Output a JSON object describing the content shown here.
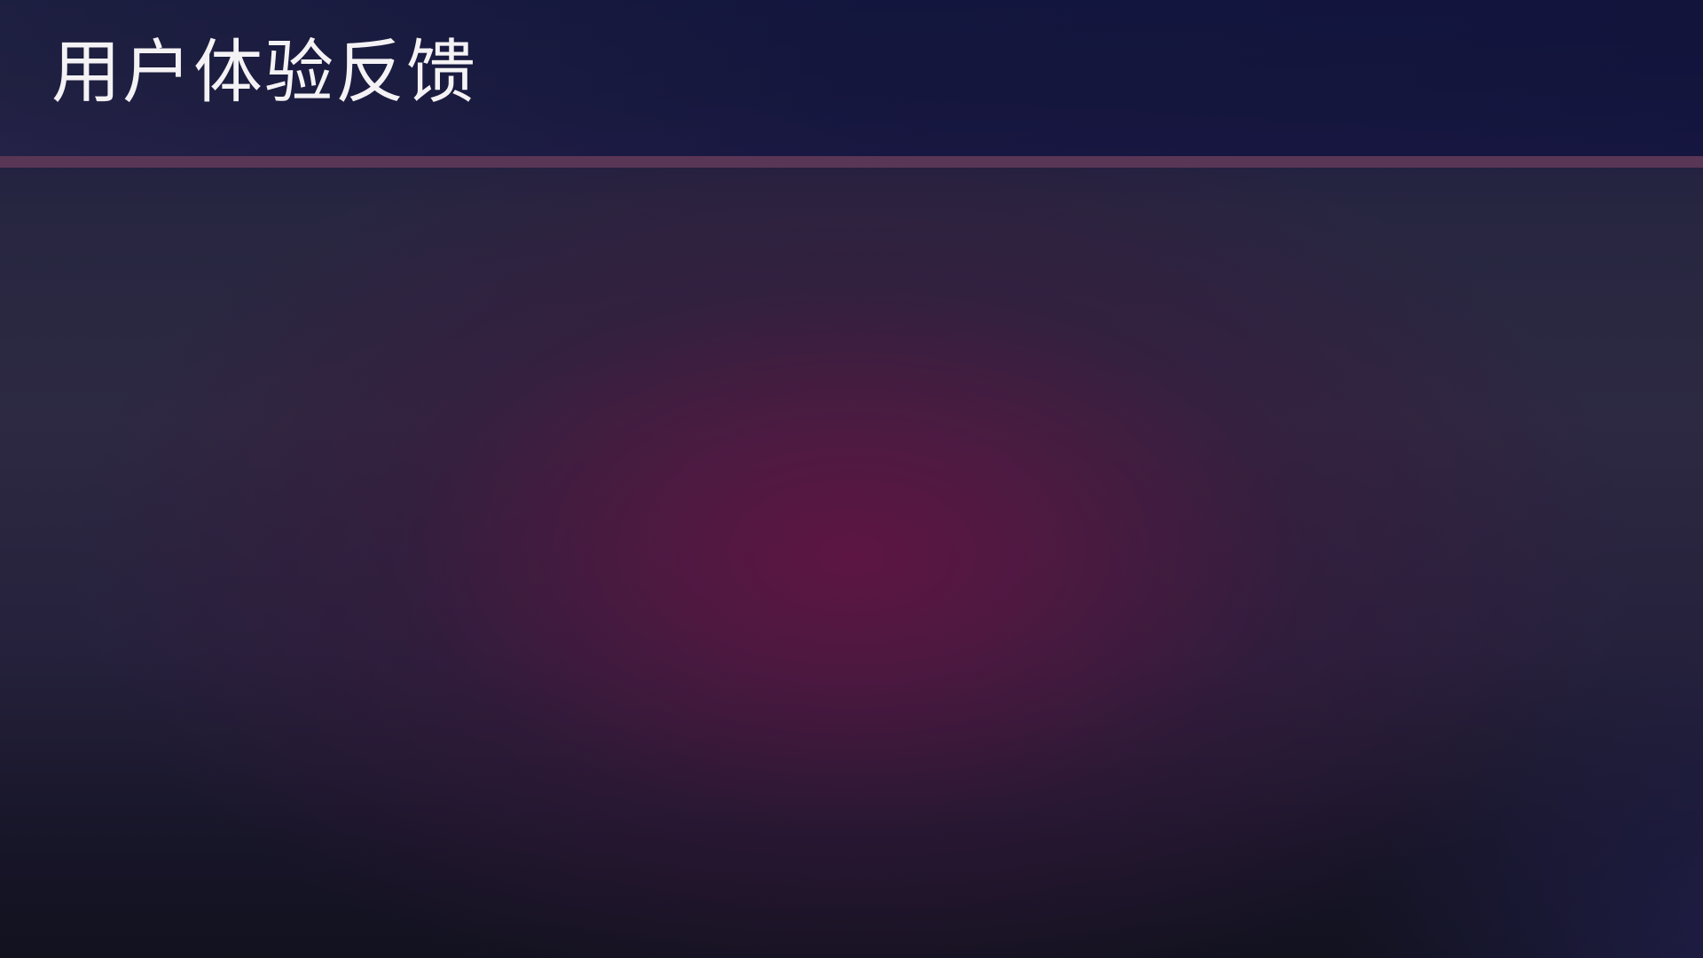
{
  "page": {
    "title": "用户体验反馈"
  },
  "colors": {
    "header_background": "#141638",
    "divider": "#5a3656",
    "center_glow": "#5e1644",
    "title_text": "#f4f2f4"
  }
}
